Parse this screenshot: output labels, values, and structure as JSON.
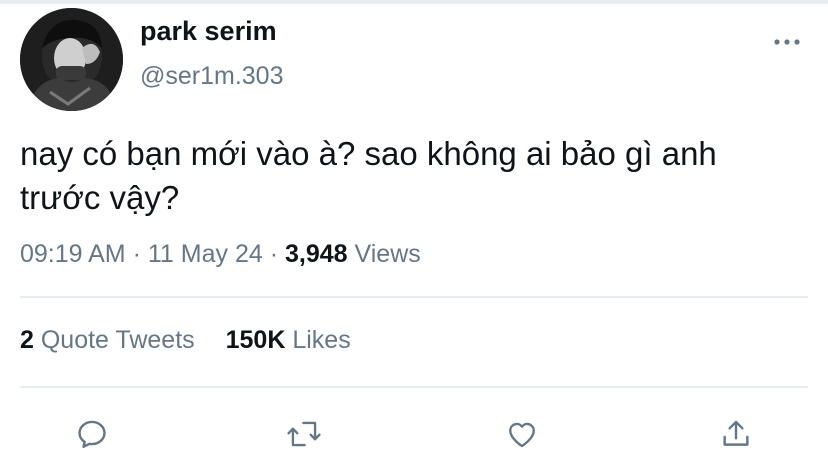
{
  "tweet": {
    "author": {
      "display_name": "park serim",
      "handle": "@ser1m.303"
    },
    "text_line1": "nay có bạn mới vào à? sao không ai bảo gì anh",
    "text_line2": "trước vậy?",
    "time": "09:19 AM",
    "separator": "·",
    "date": "11 May 24",
    "views_count": "3,948",
    "views_label": "Views",
    "quote_tweets_count": "2",
    "quote_tweets_label": "Quote Tweets",
    "likes_count": "150K",
    "likes_label": "Likes"
  },
  "icons": {
    "more": "more-horizontal-icon",
    "reply": "reply-bubble-icon",
    "retweet": "retweet-icon",
    "like": "heart-icon",
    "share": "share-upload-icon"
  },
  "colors": {
    "text_primary": "#0f1419",
    "text_secondary": "#657786",
    "divider": "#e6ecf0"
  }
}
